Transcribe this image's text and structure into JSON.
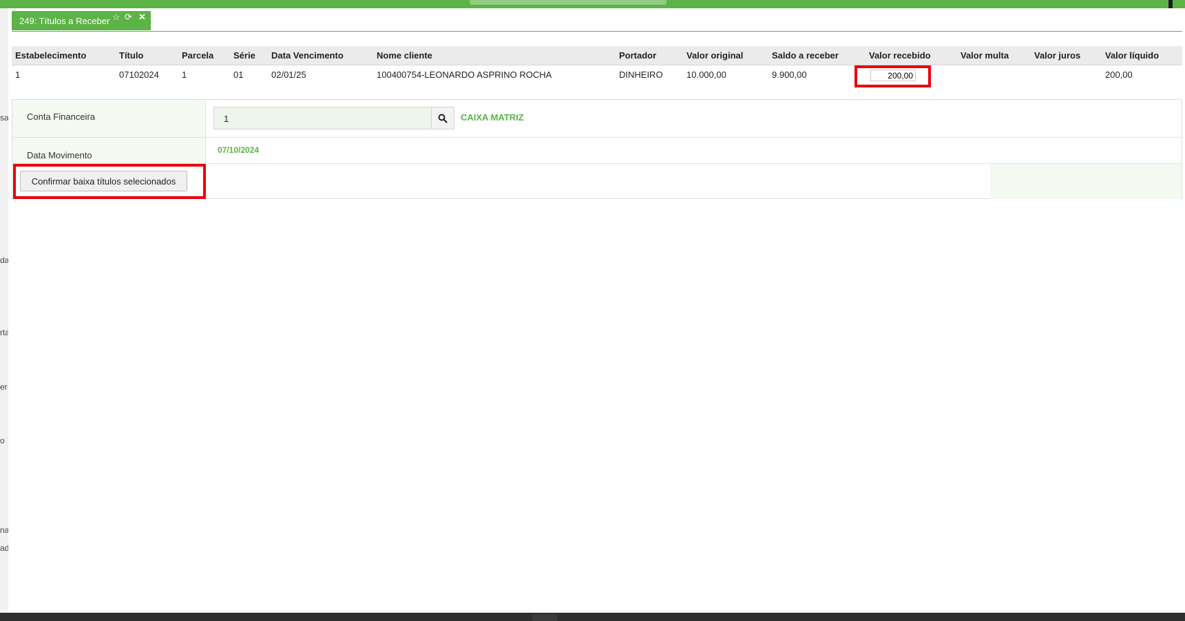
{
  "window": {
    "left_strip_fragments": [
      "sa",
      "da",
      "rta",
      "er",
      "o",
      "na",
      "ad"
    ]
  },
  "tab": {
    "title": "249: Títulos a Receber",
    "icons": {
      "favorite": "☆",
      "refresh": "⟳",
      "close": "✕"
    }
  },
  "table": {
    "headers": {
      "estabelecimento": "Estabelecimento",
      "titulo": "Título",
      "parcela": "Parcela",
      "serie": "Série",
      "data_vencimento": "Data Vencimento",
      "nome_cliente": "Nome cliente",
      "portador": "Portador",
      "valor_original": "Valor original",
      "saldo_receber": "Saldo a receber",
      "valor_recebido": "Valor recebido",
      "valor_multa": "Valor multa",
      "valor_juros": "Valor juros",
      "valor_liquido": "Valor líquido"
    },
    "row": {
      "estabelecimento": "1",
      "titulo": "07102024",
      "parcela": "1",
      "serie": "01",
      "data_vencimento": "02/01/25",
      "nome_cliente": "100400754-LEONARDO ASPRINO ROCHA",
      "portador": "DINHEIRO",
      "valor_original": "10.000,00",
      "saldo_receber": "9.900,00",
      "valor_recebido": "200,00",
      "valor_multa": "",
      "valor_juros": "",
      "valor_liquido": "200,00"
    }
  },
  "form": {
    "conta_label": "Conta Financeira",
    "conta_value": "1",
    "conta_name": "CAIXA MATRIZ",
    "data_label": "Data Movimento",
    "data_value": "07/10/2024",
    "confirm_label": "Confirmar baixa títulos selecionados"
  },
  "colors": {
    "accent_green": "#5cb346",
    "highlight_red": "#e8000b"
  }
}
